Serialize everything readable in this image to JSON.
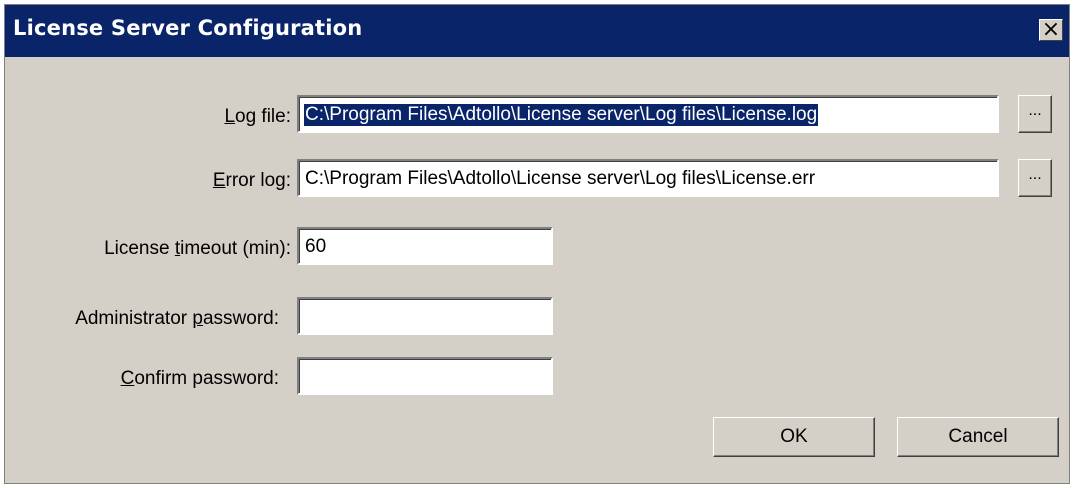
{
  "window": {
    "title": "License Server Configuration",
    "close_glyph": "×"
  },
  "form": {
    "log_file": {
      "label_pre": "",
      "label_key": "L",
      "label_post": "og file:",
      "value": "C:\\Program Files\\Adtollo\\License server\\Log files\\License.log",
      "browse": "..."
    },
    "error_log": {
      "label_pre": "",
      "label_key": "E",
      "label_post": "rror log:",
      "value": "C:\\Program Files\\Adtollo\\License server\\Log files\\License.err",
      "browse": "..."
    },
    "timeout": {
      "label_pre": "License ",
      "label_key": "t",
      "label_post": "imeout (min):",
      "value": "60"
    },
    "admin_password": {
      "label_pre": "Administrator ",
      "label_key": "p",
      "label_post": "assword:",
      "value": ""
    },
    "confirm_password": {
      "label_pre": "",
      "label_key": "C",
      "label_post": "onfirm password:",
      "value": ""
    }
  },
  "buttons": {
    "ok": "OK",
    "cancel": "Cancel"
  }
}
